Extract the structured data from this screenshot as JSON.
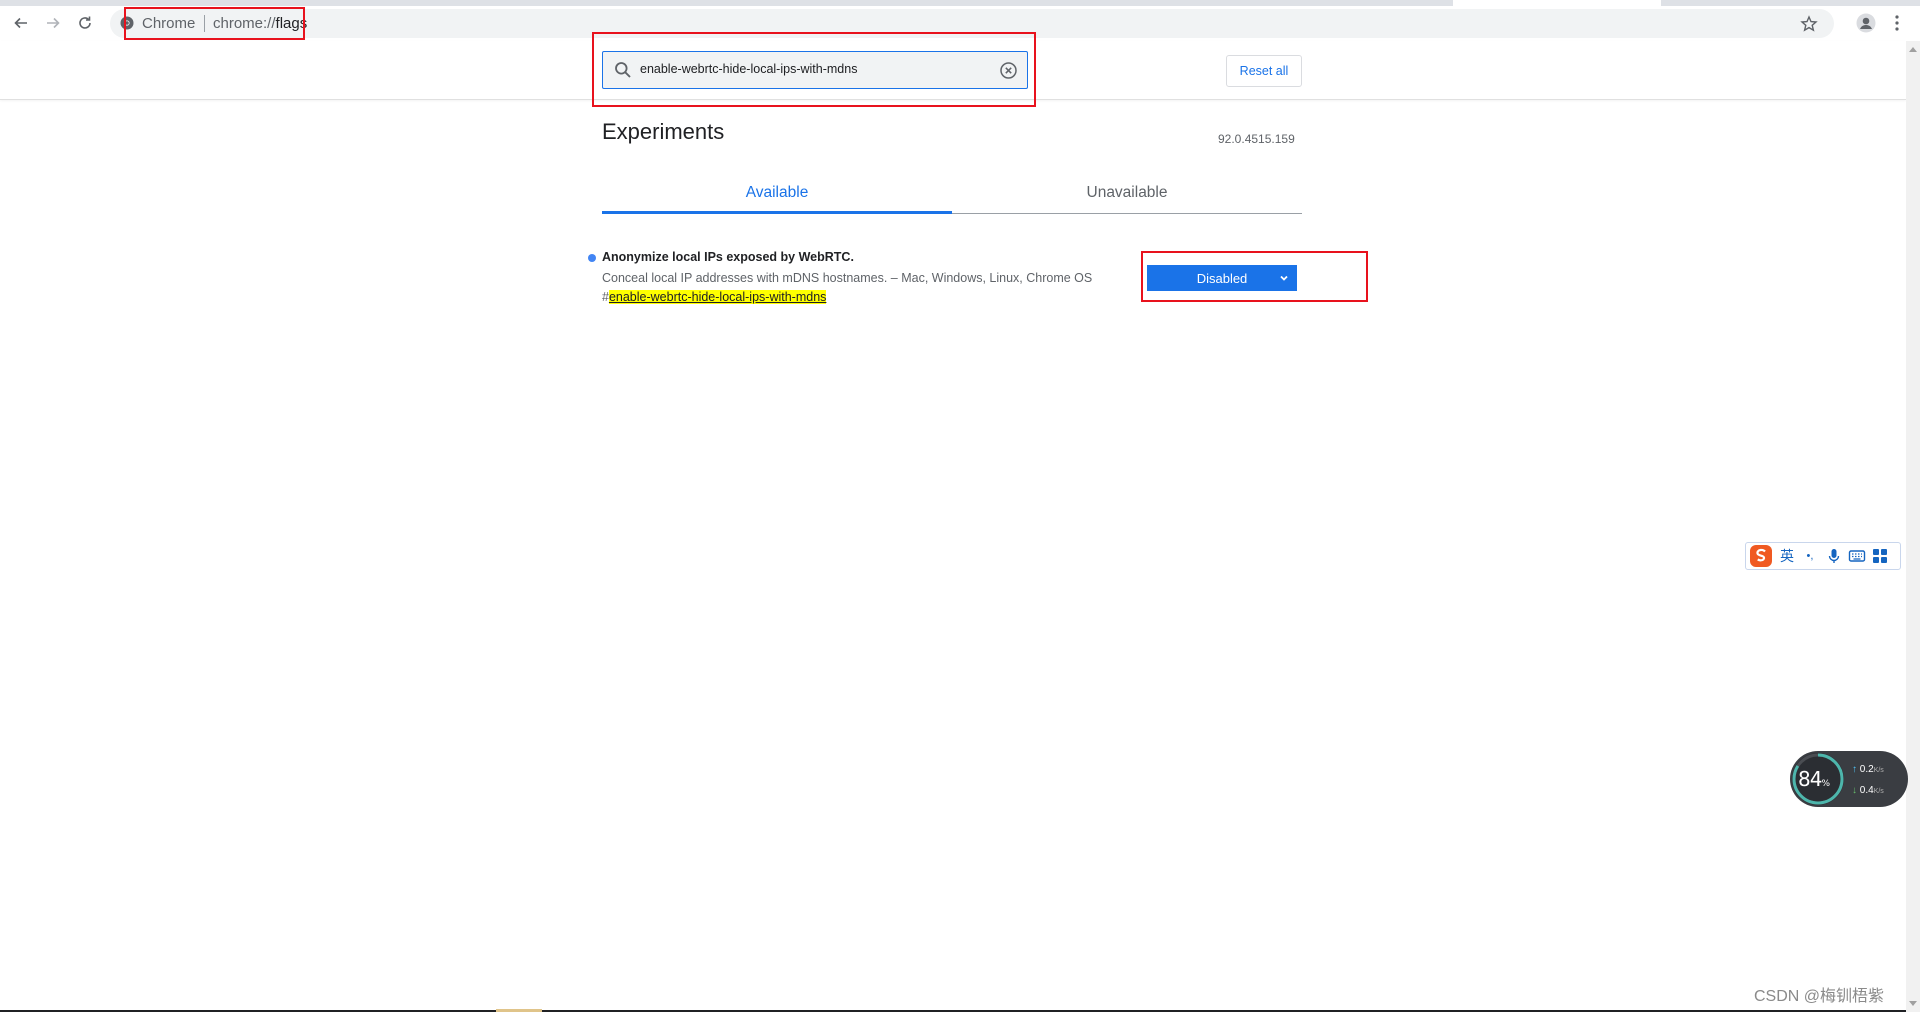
{
  "browser": {
    "site_label": "Chrome",
    "url_scheme": "chrome://",
    "url_path": "flags"
  },
  "header": {
    "search_value": "enable-webrtc-hide-local-ips-with-mdns",
    "reset_label": "Reset all"
  },
  "main": {
    "title": "Experiments",
    "version": "92.0.4515.159",
    "tabs": [
      {
        "label": "Available"
      },
      {
        "label": "Unavailable"
      }
    ],
    "flag": {
      "name": "Anonymize local IPs exposed by WebRTC.",
      "description": "Conceal local IP addresses with mDNS hostnames. – Mac, Windows, Linux, Chrome OS",
      "permalink_hash": "#",
      "permalink": "enable-webrtc-hide-local-ips-with-mdns",
      "selected_option": "Disabled"
    }
  },
  "ime": {
    "language": "英",
    "punct": "•,"
  },
  "net_monitor": {
    "percent": "84",
    "percent_unit": "%",
    "up_value": "0.2",
    "down_value": "0.4",
    "unit": "K/s",
    "level": 0.84
  },
  "watermark": "CSDN @梅钏梧紫",
  "colors": {
    "accent": "#1a73e8",
    "annotation": "#e8121d",
    "highlight": "#ffff00"
  }
}
